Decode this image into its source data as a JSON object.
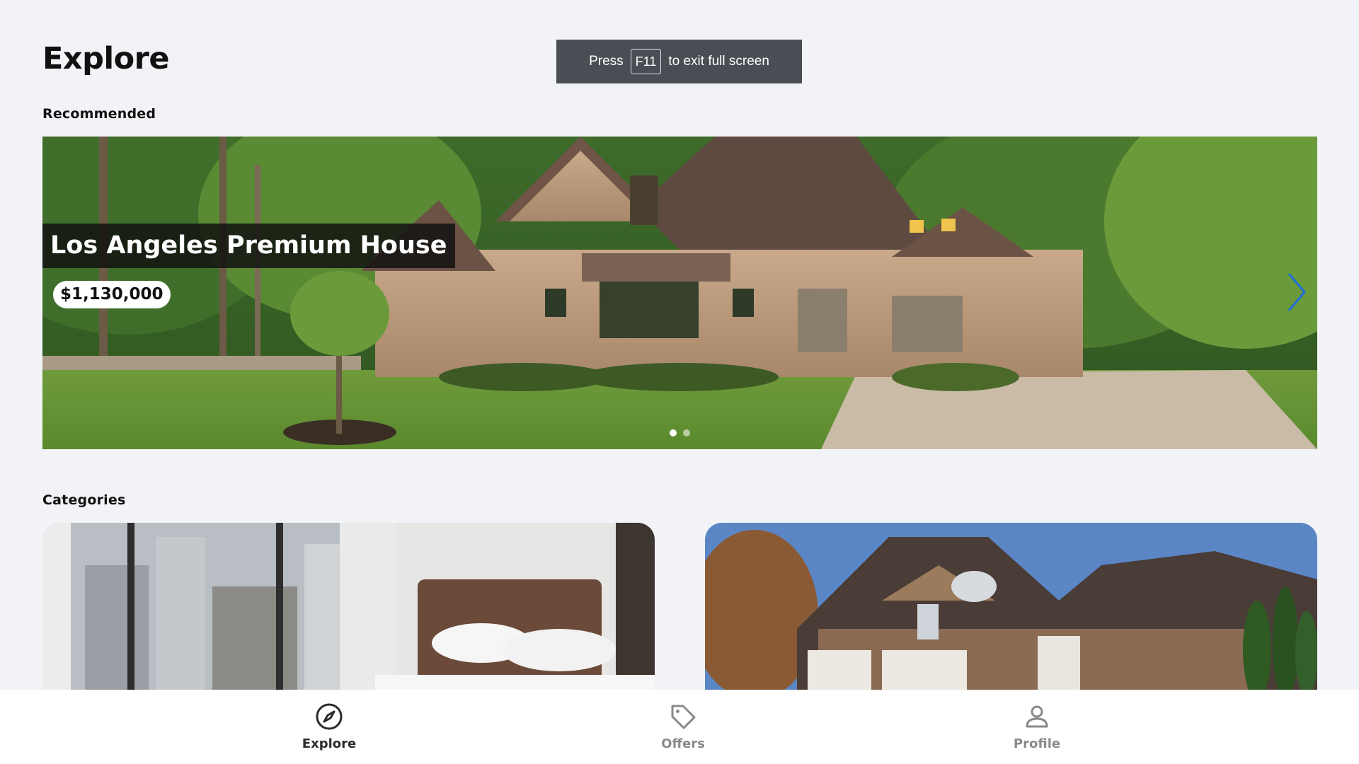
{
  "header": {
    "title": "Explore"
  },
  "fullscreen_toast": {
    "prefix": "Press",
    "key": "F11",
    "suffix": "to exit full screen"
  },
  "sections": {
    "recommended": "Recommended",
    "categories": "Categories"
  },
  "carousel": {
    "slides": [
      {
        "title": "Los Angeles Premium House",
        "price": "$1,130,000"
      }
    ],
    "active_index": 0,
    "slide_count": 2,
    "next_icon": "chevron-right-icon",
    "accent_color": "#1e6fd9"
  },
  "categories": [
    {
      "image": "hotel-bedroom-photo"
    },
    {
      "image": "suburban-house-photo"
    }
  ],
  "bottom_nav": {
    "items": [
      {
        "label": "Explore",
        "icon": "compass-icon",
        "active": true
      },
      {
        "label": "Offers",
        "icon": "tag-icon",
        "active": false
      },
      {
        "label": "Profile",
        "icon": "user-icon",
        "active": false
      }
    ]
  }
}
